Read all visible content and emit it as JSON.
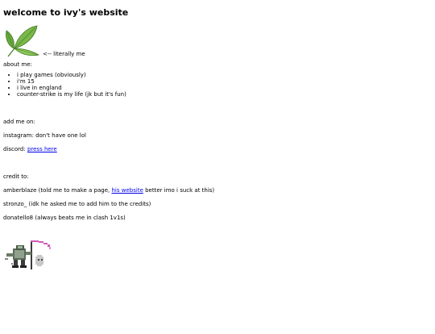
{
  "title": "welcome to ivy's website",
  "leaf": {
    "icon": "leaf-icon",
    "caption": "<-- literally me"
  },
  "about": {
    "heading": "about me:",
    "items": [
      "i play games (obviously)",
      "i'm 15",
      "i live in england",
      "counter-strike is my life (jk but it's fun)"
    ]
  },
  "add": {
    "heading": "add me on:",
    "instagram": "instagram: don't have one lol",
    "discord_prefix": "discord: ",
    "discord_link": "press here"
  },
  "credits": {
    "heading": "credit to:",
    "amberblaze_prefix": "amberblaze (told me to make a page, ",
    "amberblaze_link": "his website",
    "amberblaze_suffix": " better imo i suck at this)",
    "stronzo": "stronzo_ (idk he asked me to add him to the credits)",
    "donatello": "donatello8 (always beats me in clash 1v1s)"
  },
  "sprite": {
    "icon": "knight-with-scythe-sprite-icon"
  },
  "colors": {
    "link": "#0000ee",
    "leaf": "#6aa83a",
    "leaf_dark": "#3f7a1f"
  }
}
